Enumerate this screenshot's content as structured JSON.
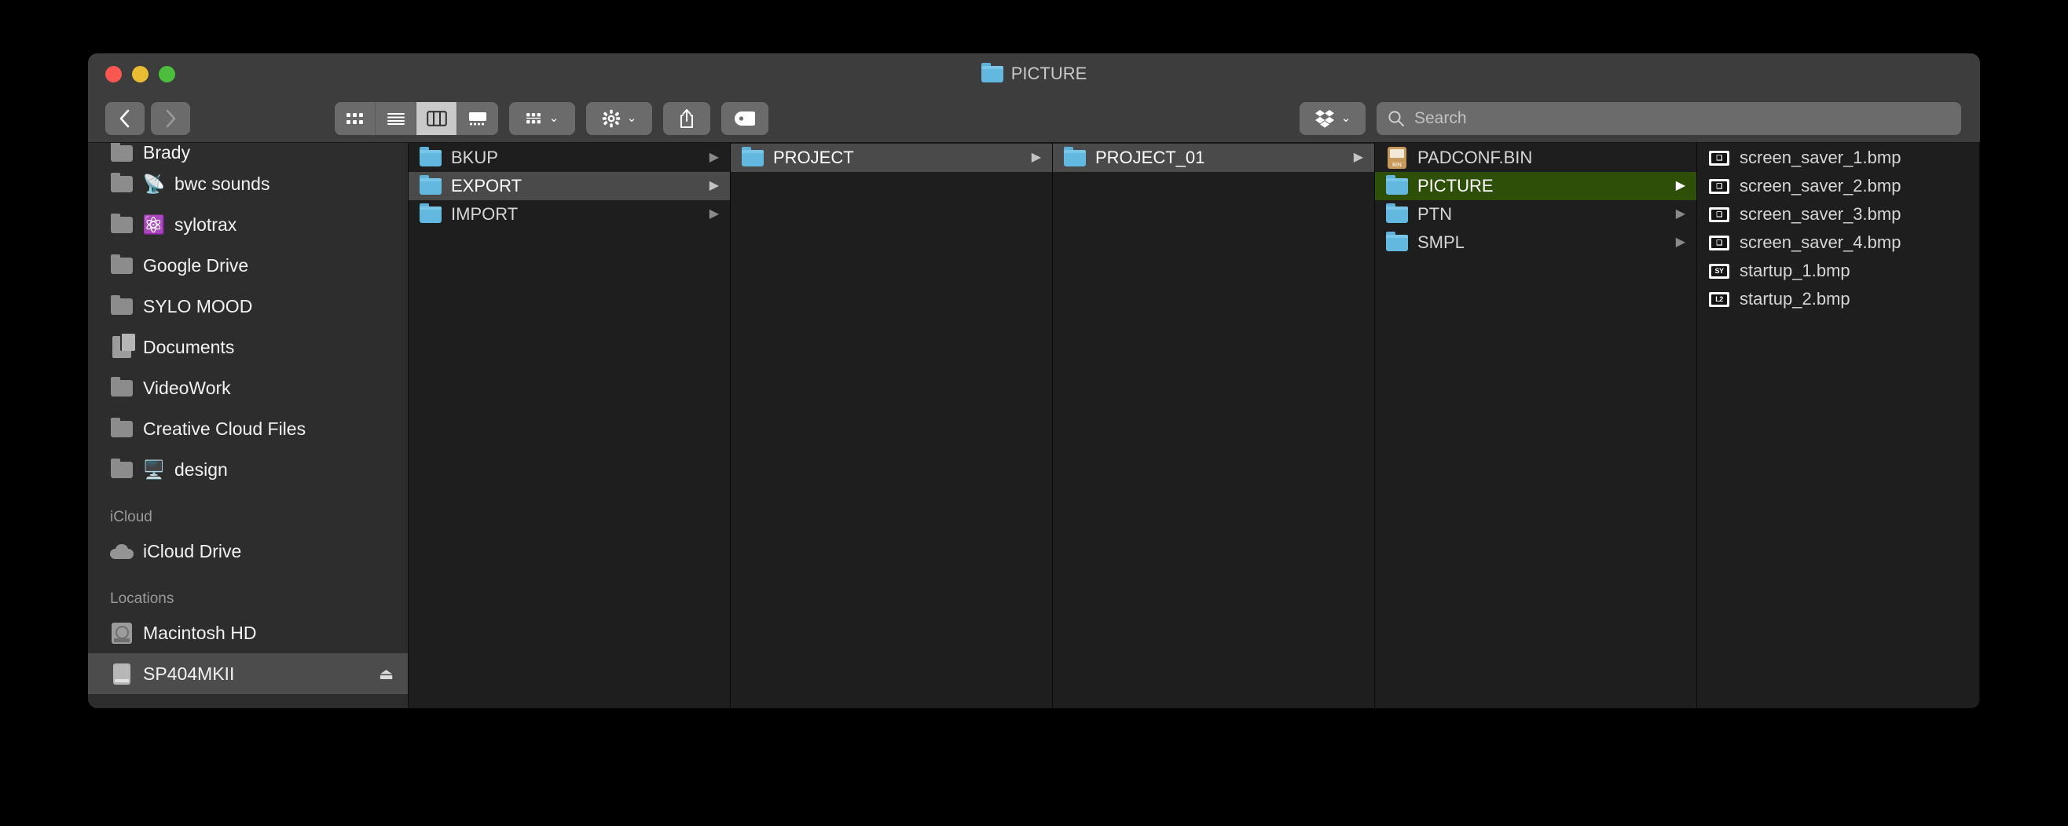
{
  "window": {
    "title": "PICTURE",
    "title_icon": "folder-icon",
    "traffic_lights": {
      "close_label": "Close",
      "minimize_label": "Minimize",
      "zoom_label": "Zoom"
    }
  },
  "toolbar": {
    "back_label": "Back",
    "forward_label": "Forward",
    "view_modes": [
      {
        "name": "icon-view",
        "label": "Icon View",
        "active": false
      },
      {
        "name": "list-view",
        "label": "List View",
        "active": false
      },
      {
        "name": "column-view",
        "label": "Column View",
        "active": true
      },
      {
        "name": "gallery-view",
        "label": "Gallery View",
        "active": false
      }
    ],
    "group_label": "Group",
    "action_label": "Action",
    "share_label": "Share",
    "tags_label": "Tags",
    "dropbox_label": "Dropbox",
    "chevron": "⌄"
  },
  "search": {
    "placeholder": "Search",
    "value": "",
    "icon": "search-icon"
  },
  "sidebar": {
    "favorites": [
      {
        "label": "Brady",
        "icon": "folder-icon",
        "emoji": "",
        "clipped": true,
        "selected": false
      },
      {
        "label": "bwc sounds",
        "icon": "folder-icon",
        "emoji": "📡",
        "clipped": false,
        "selected": false
      },
      {
        "label": "sylotrax",
        "icon": "folder-icon",
        "emoji": "⚛️",
        "clipped": false,
        "selected": false
      },
      {
        "label": "Google Drive",
        "icon": "folder-icon",
        "emoji": "",
        "clipped": false,
        "selected": false
      },
      {
        "label": "SYLO MOOD",
        "icon": "folder-icon",
        "emoji": "",
        "clipped": false,
        "selected": false
      },
      {
        "label": "Documents",
        "icon": "documents-icon",
        "emoji": "",
        "clipped": false,
        "selected": false
      },
      {
        "label": "VideoWork",
        "icon": "folder-icon",
        "emoji": "",
        "clipped": false,
        "selected": false
      },
      {
        "label": "Creative Cloud Files",
        "icon": "folder-icon",
        "emoji": "",
        "clipped": false,
        "selected": false
      },
      {
        "label": "design",
        "icon": "folder-icon",
        "emoji": "🖥️",
        "clipped": false,
        "selected": false
      }
    ],
    "icloud_header": "iCloud",
    "icloud": [
      {
        "label": "iCloud Drive",
        "icon": "cloud-icon",
        "selected": false
      }
    ],
    "locations_header": "Locations",
    "locations": [
      {
        "label": "Macintosh HD",
        "icon": "harddisk-icon",
        "selected": false,
        "eject": false
      },
      {
        "label": "SP404MKII",
        "icon": "disk-icon",
        "selected": true,
        "eject": true
      }
    ],
    "eject_glyph": "⏏"
  },
  "columns": [
    {
      "name": "column-1",
      "items": [
        {
          "label": "BKUP",
          "icon": "folder-icon",
          "arrow": true,
          "selection": "none"
        },
        {
          "label": "EXPORT",
          "icon": "folder-icon",
          "arrow": true,
          "selection": "gray"
        },
        {
          "label": "IMPORT",
          "icon": "folder-icon",
          "arrow": true,
          "selection": "none"
        }
      ]
    },
    {
      "name": "column-2",
      "items": [
        {
          "label": "PROJECT",
          "icon": "folder-icon",
          "arrow": true,
          "selection": "gray"
        }
      ]
    },
    {
      "name": "column-3",
      "items": [
        {
          "label": "PROJECT_01",
          "icon": "folder-icon",
          "arrow": true,
          "selection": "gray"
        }
      ]
    },
    {
      "name": "column-4",
      "items": [
        {
          "label": "PADCONF.BIN",
          "icon": "bin-file-icon",
          "arrow": false,
          "selection": "none"
        },
        {
          "label": "PICTURE",
          "icon": "folder-icon",
          "arrow": true,
          "selection": "green"
        },
        {
          "label": "PTN",
          "icon": "folder-icon",
          "arrow": true,
          "selection": "none"
        },
        {
          "label": "SMPL",
          "icon": "folder-icon",
          "arrow": true,
          "selection": "none"
        }
      ]
    },
    {
      "name": "column-5",
      "items": [
        {
          "label": "screen_saver_1.bmp",
          "icon": "bmp-file-icon",
          "thumb": "❑",
          "arrow": false,
          "selection": "none"
        },
        {
          "label": "screen_saver_2.bmp",
          "icon": "bmp-file-icon",
          "thumb": "❑",
          "arrow": false,
          "selection": "none"
        },
        {
          "label": "screen_saver_3.bmp",
          "icon": "bmp-file-icon",
          "thumb": "❑",
          "arrow": false,
          "selection": "none"
        },
        {
          "label": "screen_saver_4.bmp",
          "icon": "bmp-file-icon",
          "thumb": "❑",
          "arrow": false,
          "selection": "none"
        },
        {
          "label": "startup_1.bmp",
          "icon": "bmp-file-icon",
          "thumb": "SY",
          "arrow": false,
          "selection": "none"
        },
        {
          "label": "startup_2.bmp",
          "icon": "bmp-file-icon",
          "thumb": "L2",
          "arrow": false,
          "selection": "none"
        }
      ]
    }
  ],
  "colors": {
    "accent_selection_green": "#2d4f08",
    "inactive_selection_gray": "#4a4a4a",
    "folder_blue": "#63b8e0",
    "window_chrome": "#3d3d3d",
    "sidebar_bg": "#2d2d2d",
    "column_bg": "#1e1e1e",
    "traffic_red": "#f9574f",
    "traffic_yellow": "#e9bd33",
    "traffic_green": "#4cbd3c"
  }
}
